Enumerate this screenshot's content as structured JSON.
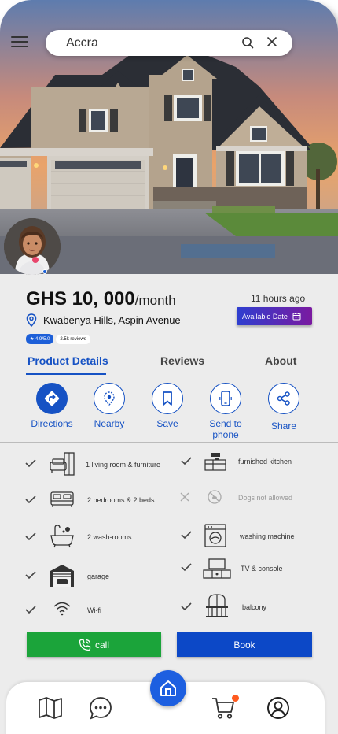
{
  "search": {
    "value": "Accra"
  },
  "listing": {
    "price": "GHS 10, 000",
    "price_unit": "/month",
    "posted": "11 hours ago",
    "location": "Kwabenya Hills, Aspin Avenue",
    "available_label": "Available Date",
    "rating": "★ 4.9/5.0",
    "reviews": "2.5k reviews"
  },
  "tabs": [
    {
      "label": "Product Details"
    },
    {
      "label": "Reviews"
    },
    {
      "label": "About"
    }
  ],
  "actions": [
    {
      "label": "Directions",
      "icon": "directions-icon"
    },
    {
      "label": "Nearby",
      "icon": "nearby-icon"
    },
    {
      "label": "Save",
      "icon": "bookmark-icon"
    },
    {
      "label": "Send  to\nphone",
      "icon": "phone-icon"
    },
    {
      "label": "Share",
      "icon": "share-icon"
    }
  ],
  "amenities_left": [
    {
      "label": "1 living room & furniture",
      "available": true
    },
    {
      "label": "2 bedrooms & 2 beds",
      "available": true
    },
    {
      "label": "2 wash-rooms",
      "available": true
    },
    {
      "label": "garage",
      "available": true
    },
    {
      "label": "Wi-fi",
      "available": true
    }
  ],
  "amenities_right": [
    {
      "label": "furnished kitchen",
      "available": true
    },
    {
      "label": "Dogs not allowed",
      "available": false
    },
    {
      "label": "washing machine",
      "available": true
    },
    {
      "label": "TV & console",
      "available": true
    },
    {
      "label": "balcony",
      "available": true
    }
  ],
  "buttons": {
    "call": "call",
    "book": "Book"
  },
  "colors": {
    "primary": "#1652c4",
    "call": "#1ba43a",
    "book": "#0c48c7",
    "badge": "#ff5a1f"
  }
}
